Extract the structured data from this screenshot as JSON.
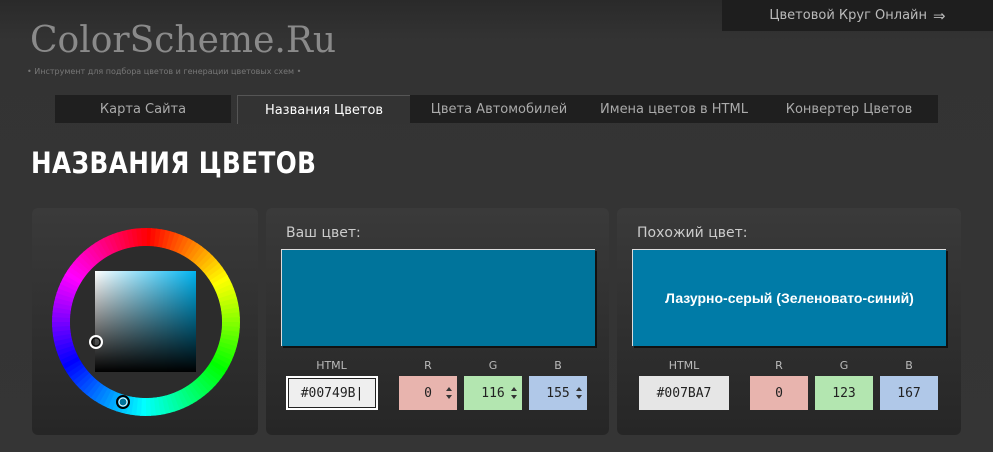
{
  "header": {
    "brand": "ColorScheme.Ru",
    "tagline": "• Инструмент для подбора цветов и генерации цветовых схем •",
    "top_link": "Цветовой Круг Онлайн",
    "top_link_arrow": "⇒"
  },
  "nav": {
    "tabs": [
      {
        "label": "Карта Сайта",
        "active": false
      },
      {
        "label": "Названия Цветов",
        "active": true
      },
      {
        "label": "Цвета Автомобилей",
        "active": false
      },
      {
        "label": "Имена цветов в HTML",
        "active": false
      },
      {
        "label": "Конвертер Цветов",
        "active": false
      }
    ]
  },
  "page_title": "НАЗВАНИЯ ЦВЕТОВ",
  "your_color": {
    "label": "Ваш цвет:",
    "swatch_color": "#00749B",
    "html_label": "HTML",
    "html_value": "#00749B",
    "r_label": "R",
    "r_value": "0",
    "g_label": "G",
    "g_value": "116",
    "b_label": "B",
    "b_value": "155"
  },
  "similar_color": {
    "label": "Похожий цвет:",
    "swatch_color": "#007BA7",
    "name": "Лазурно-серый (Зеленовато-синий)",
    "html_label": "HTML",
    "html_value": "#007BA7",
    "r_label": "R",
    "r_value": "0",
    "g_label": "G",
    "g_value": "123",
    "b_label": "B",
    "b_value": "167"
  },
  "colors": {
    "r_field": "#e8b4ae",
    "g_field": "#b3e6b0",
    "b_field": "#b0c8e8",
    "html_field": "#e6e6e6"
  }
}
